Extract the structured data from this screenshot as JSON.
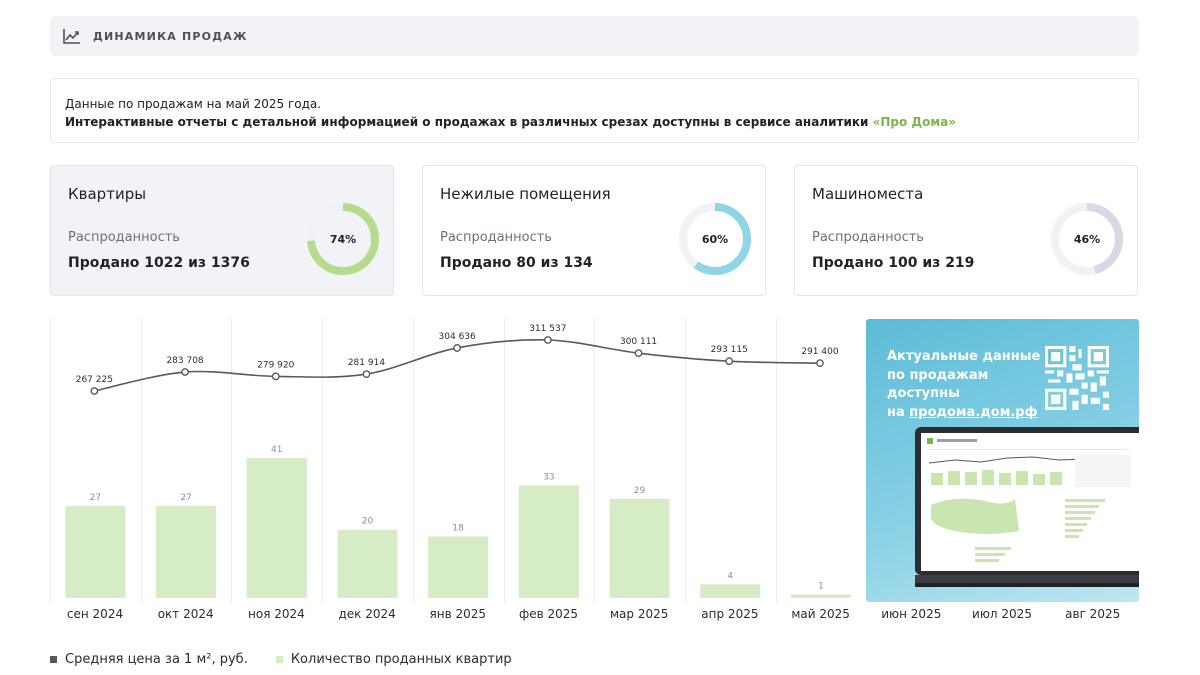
{
  "header": {
    "title": "ДИНАМИКА ПРОДАЖ",
    "icon": "trend-chart-icon"
  },
  "info": {
    "line1": "Данные по продажам на май 2025 года.",
    "line2": "Интерактивные отчеты с детальной информацией о продажах в различных срезах доступны в сервисе аналитики ",
    "link": "«Про Дома»"
  },
  "cards": [
    {
      "title": "Квартиры",
      "subtitle": "Распроданность",
      "value": "Продано 1022 из 1376",
      "percent_label": "74%",
      "percent": 74,
      "color": "#b5dc8d"
    },
    {
      "title": "Нежилые помещения",
      "subtitle": "Распроданность",
      "value": "Продано 80 из 134",
      "percent_label": "60%",
      "percent": 60,
      "color": "#8ed6e6"
    },
    {
      "title": "Машиноместа",
      "subtitle": "Распроданность",
      "value": "Продано 100 из 219",
      "percent_label": "46%",
      "percent": 46,
      "color": "#d8d9e4"
    }
  ],
  "promo": {
    "line1": "Актуальные данные",
    "line2": "по продажам доступны",
    "prefix": "на ",
    "link": "продома.дом.рф",
    "icon": "qr-code-icon"
  },
  "legend": [
    {
      "label": "Средняя цена за 1 м², руб.",
      "color": "#555a61"
    },
    {
      "label": "Количество проданных квартир",
      "color": "#d6ecc5"
    }
  ],
  "chart_data": {
    "type": "bar",
    "categories": [
      "сен 2024",
      "окт 2024",
      "ноя 2024",
      "дек 2024",
      "янв 2025",
      "фев 2025",
      "мар 2025",
      "апр 2025",
      "май 2025",
      "июн 2025",
      "июл 2025",
      "авг 2025"
    ],
    "series": [
      {
        "name": "Количество проданных квартир",
        "type": "bar",
        "color": "#d6ecc5",
        "values": [
          27,
          27,
          41,
          20,
          18,
          33,
          29,
          4,
          1,
          null,
          null,
          null
        ]
      },
      {
        "name": "Средняя цена за 1 м², руб.",
        "type": "line",
        "color": "#555a61",
        "values": [
          267225,
          283708,
          279920,
          281914,
          304636,
          311537,
          300111,
          293115,
          291400,
          null,
          null,
          null
        ],
        "labels": [
          "267 225",
          "283 708",
          "279 920",
          "281 914",
          "304 636",
          "311 537",
          "300 111",
          "293 115",
          "291 400"
        ]
      }
    ],
    "grid": "vertical"
  }
}
